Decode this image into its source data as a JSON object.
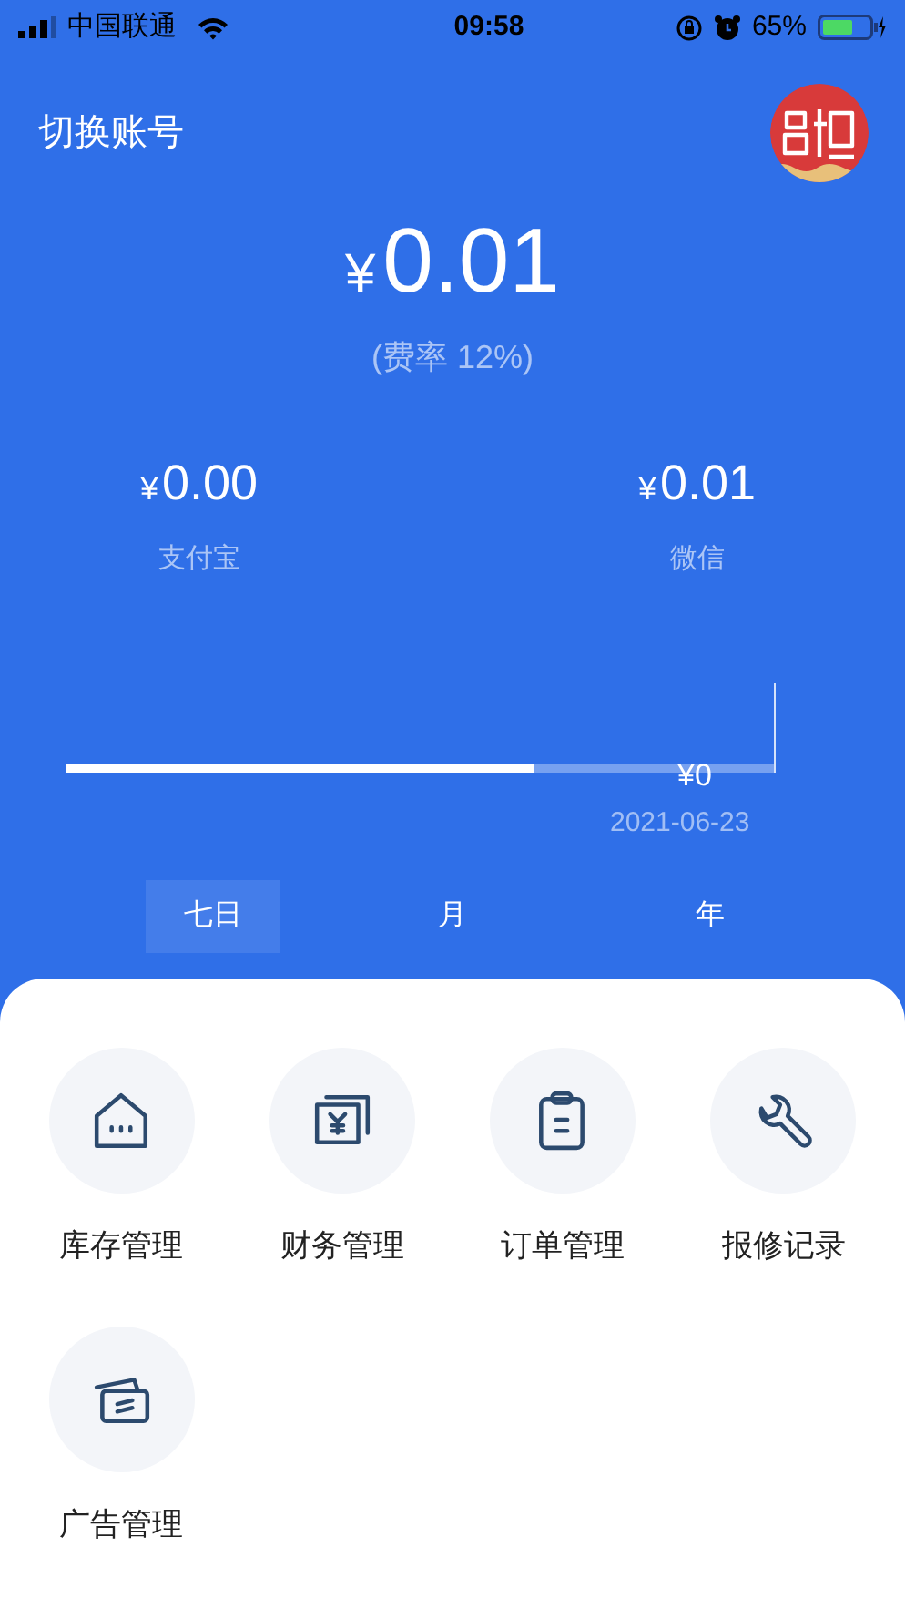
{
  "status_bar": {
    "carrier": "中国联通",
    "time": "09:58",
    "battery": "65%"
  },
  "header": {
    "switch_account": "切换账号"
  },
  "total": {
    "currency": "¥",
    "amount": "0.01",
    "rate": "(费率 12%)"
  },
  "channels": [
    {
      "currency": "¥",
      "amount": "0.00",
      "label": "支付宝"
    },
    {
      "currency": "¥",
      "amount": "0.01",
      "label": "微信"
    }
  ],
  "trend": {
    "level": 0.66,
    "tooltip": "¥0",
    "date": "2021-06-23"
  },
  "tabs": [
    {
      "label": "七日",
      "selected": true
    },
    {
      "label": "月",
      "selected": false
    },
    {
      "label": "年",
      "selected": false
    }
  ],
  "menu": [
    {
      "kind": "warehouse",
      "label": "库存管理"
    },
    {
      "kind": "finance",
      "label": "财务管理"
    },
    {
      "kind": "clipboard",
      "label": "订单管理"
    },
    {
      "kind": "wrench",
      "label": "报修记录"
    },
    {
      "kind": "cards",
      "label": "广告管理"
    }
  ]
}
